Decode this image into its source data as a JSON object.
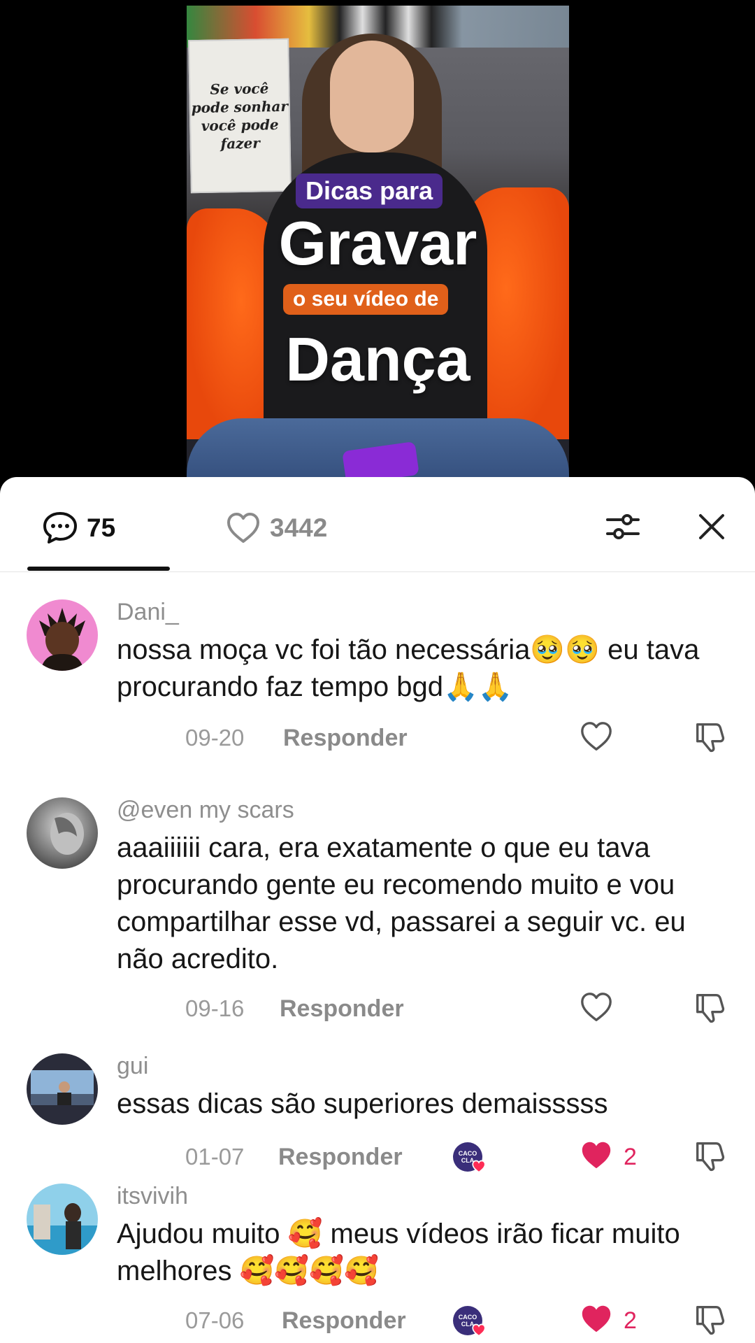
{
  "video": {
    "poster_text": "Se você\npode sonhar\nvocê pode\nfazer",
    "overlay_line1": "Dicas para",
    "overlay_line2": "Gravar",
    "overlay_line3": "o seu vídeo de",
    "overlay_line4": "Dança"
  },
  "tabs": {
    "comments_count": "75",
    "likes_count": "3442"
  },
  "comments": [
    {
      "username": "Dani_",
      "text": "nossa moça vc foi tão necessária🥹🥹 eu tava procurando faz tempo bgd🙏🙏",
      "date": "09-20",
      "reply_label": "Responder",
      "likes": "",
      "liked": false,
      "creator_liked": false
    },
    {
      "username": "@even my scars",
      "text": "aaaiiiiii cara, era exatamente o que eu tava procurando gente eu recomendo muito e vou compartilhar esse vd, passarei a seguir vc. eu não acredito.",
      "date": "09-16",
      "reply_label": "Responder",
      "likes": "",
      "liked": false,
      "creator_liked": false
    },
    {
      "username": "gui",
      "text": "essas dicas são superiores demaisssss",
      "date": "01-07",
      "reply_label": "Responder",
      "likes": "2",
      "liked": true,
      "creator_liked": true,
      "creator_badge": "CACO CLA"
    },
    {
      "username": "itsvivih",
      "text": "Ajudou muito 🥰 meus vídeos irão ficar muito melhores 🥰🥰🥰🥰",
      "date": "07-06",
      "reply_label": "Responder",
      "likes": "2",
      "liked": true,
      "creator_liked": true,
      "creator_badge": "CACO CLA"
    }
  ],
  "colors": {
    "like_active": "#e0245e",
    "text_primary": "#161616",
    "text_secondary": "#8e8e8e"
  },
  "icons": [
    "comment-icon",
    "heart-icon",
    "filter-icon",
    "close-icon",
    "dislike-icon"
  ]
}
